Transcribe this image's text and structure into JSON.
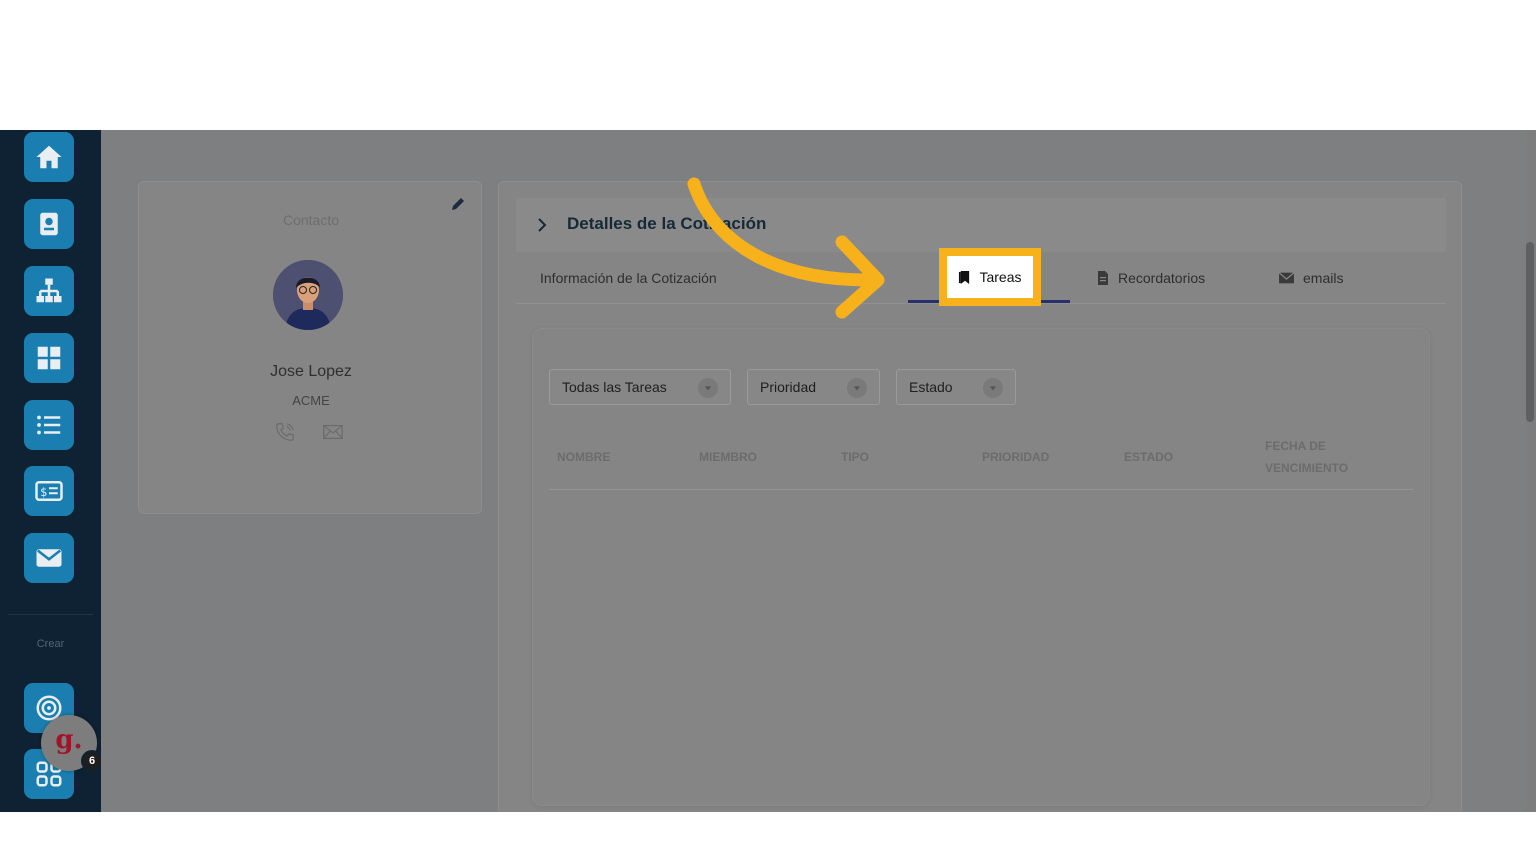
{
  "sidebar": {
    "items": [
      {
        "icon": "home-icon"
      },
      {
        "icon": "contact-card-icon"
      },
      {
        "icon": "org-chart-icon"
      },
      {
        "icon": "grid-icon"
      },
      {
        "icon": "list-icon"
      },
      {
        "icon": "invoice-icon"
      },
      {
        "icon": "mail-icon"
      },
      {
        "icon": "target-icon"
      },
      {
        "icon": "apps-icon"
      }
    ],
    "create_label": "Crear",
    "user_initial": "g.",
    "notification_count": "6"
  },
  "contact": {
    "title": "Contacto",
    "name": "Jose Lopez",
    "company": "ACME"
  },
  "detail": {
    "header_title": "Detalles de la Cotización",
    "tabs": [
      {
        "label": "Información de la Cotización",
        "icon": ""
      },
      {
        "label": "Tareas",
        "icon": "bookmark-icon",
        "active": true
      },
      {
        "label": "Recordatorios",
        "icon": "document-icon"
      },
      {
        "label": "emails",
        "icon": "envelope-icon"
      }
    ]
  },
  "tasks": {
    "filters": [
      {
        "label": "Todas las Tareas"
      },
      {
        "label": "Prioridad"
      },
      {
        "label": "Estado"
      }
    ],
    "columns": [
      "NOMBRE",
      "MIEMBRO",
      "TIPO",
      "PRIORIDAD",
      "ESTADO",
      "FECHA DE",
      "VENCIMIENTO"
    ]
  },
  "colors": {
    "sidebar_bg": "#0f2233",
    "sidebar_button": "#1a7fb0",
    "highlight": "#f7b21b",
    "active_tab_underline": "#27306b"
  }
}
